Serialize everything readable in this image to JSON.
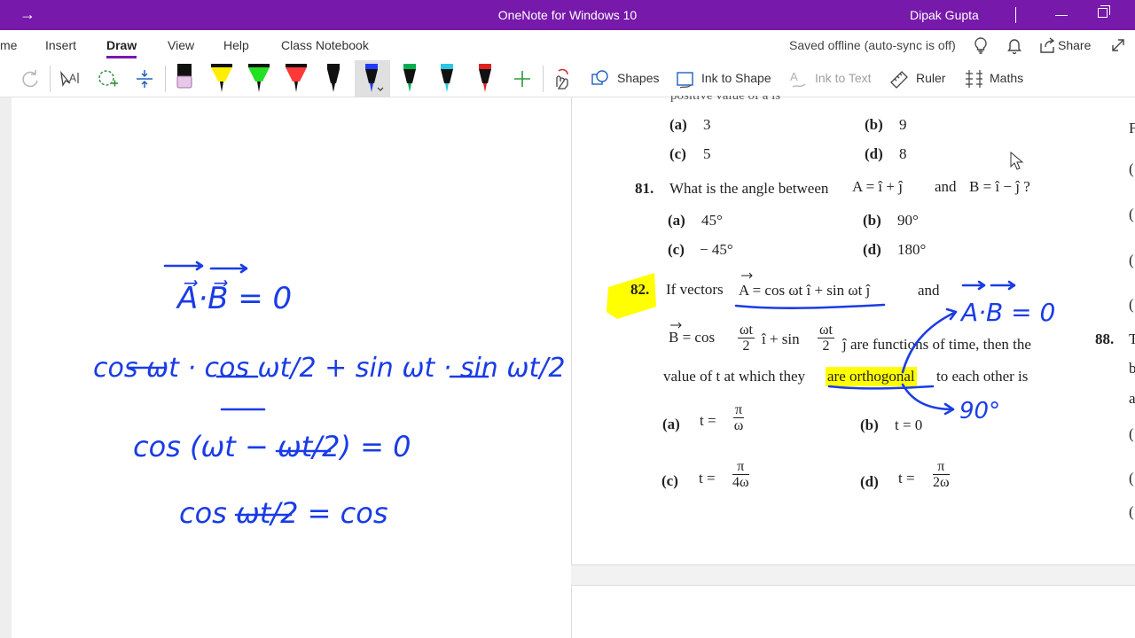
{
  "titlebar": {
    "app_title": "OneNote for Windows 10",
    "user_name": "Dipak Gupta",
    "bar_color": "#7719aa"
  },
  "menu": {
    "tabs": [
      "me",
      "Insert",
      "Draw",
      "View",
      "Help",
      "Class Notebook"
    ],
    "active_tab": "Draw",
    "sync_status": "Saved offline (auto-sync is off)",
    "share_label": "Share"
  },
  "toolbar": {
    "pen_colors": [
      "#000000",
      "#ffff00",
      "#00e000",
      "#ff3030",
      "#000000",
      "#1e3cff",
      "#00b050",
      "#28c8e6",
      "#e02020"
    ],
    "selected_pen_color": "#1e3cff",
    "shapes_label": "Shapes",
    "ink_to_shape_label": "Ink to Shape",
    "ink_to_text_label": "Ink to Text",
    "ruler_label": "Ruler",
    "maths_label": "Maths"
  },
  "ink": {
    "color": "#1a3ce6",
    "line1": "A⃗·B⃗  = 0",
    "line2": "cos ωt · cos ωt/2 + sin ωt · sin ωt/2",
    "line3": "cos (ωt − ωt/2) = 0",
    "line4": "cos ωt/2 = cos",
    "annot_top": "A·B = 0",
    "annot_bottom": "90°"
  },
  "question_page": {
    "cut_text": "positive value of a is",
    "q80_options": {
      "a": "3",
      "b": "9",
      "c": "5",
      "d": "8"
    },
    "q81": {
      "number": "81.",
      "text_pre": "What is the angle between",
      "text_a": "A = î + ĵ",
      "text_and": "and",
      "text_b": "B = î − ĵ ?",
      "options": {
        "a": "45°",
        "b": "90°",
        "c": "− 45°",
        "d": "180°"
      }
    },
    "q82": {
      "number": "82.",
      "text_if": "If vectors",
      "vec_a": "A = cos ωt î + sin ωt ĵ",
      "and": "and",
      "vec_b_pre": "B = cos",
      "frac_num": "ωt",
      "frac_den": "2",
      "mid": "î + sin",
      "tail": "ĵ are functions of time, then the",
      "line3_pre": "value of t at which they",
      "line3_hl": "are orthogonal",
      "line3_post": "to each other is",
      "opt_a_pre": "t =",
      "opt_a_num": "π",
      "opt_a_den": "ω",
      "opt_b": "t = 0",
      "opt_c_pre": "t =",
      "opt_c_num": "π",
      "opt_c_den": "4ω",
      "opt_d_pre": "t =",
      "opt_d_num": "π",
      "opt_d_den": "2ω"
    },
    "q88_number": "88.",
    "option_labels": {
      "a": "(a)",
      "b": "(b)",
      "c": "(c)",
      "d": "(d)"
    },
    "right_edge_letters": [
      "F",
      "(",
      "(",
      "(",
      "(",
      "T",
      "b",
      "a",
      "(",
      "(",
      "("
    ]
  }
}
